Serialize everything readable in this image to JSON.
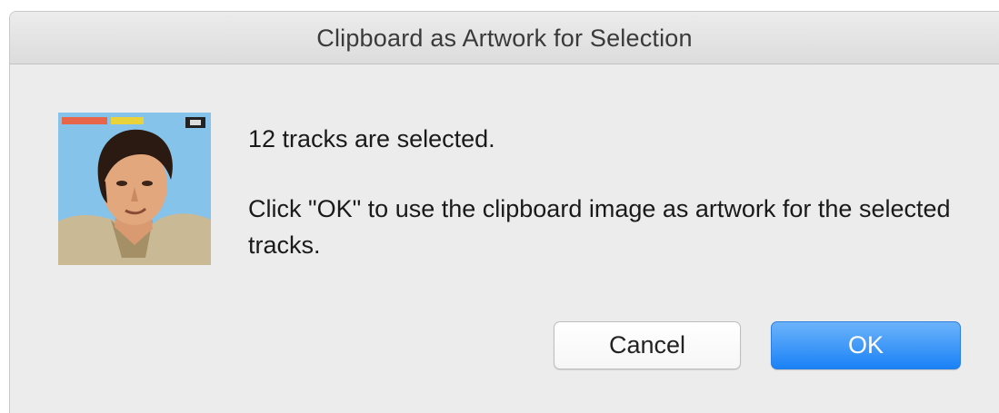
{
  "dialog": {
    "title": "Clipboard as Artwork for Selection",
    "message_primary": "12 tracks are selected.",
    "message_secondary": "Click \"OK\" to use the clipboard image as artwork for the selected tracks.",
    "artwork": {
      "description_icon": "album-artwork-thumbnail"
    },
    "buttons": {
      "cancel_label": "Cancel",
      "ok_label": "OK"
    }
  },
  "colors": {
    "window_background": "#ececec",
    "title_text": "#3a3a3a",
    "ok_button_top": "#6cb3fa",
    "ok_button_bottom": "#1a82f7",
    "cancel_button": "#ffffff"
  }
}
